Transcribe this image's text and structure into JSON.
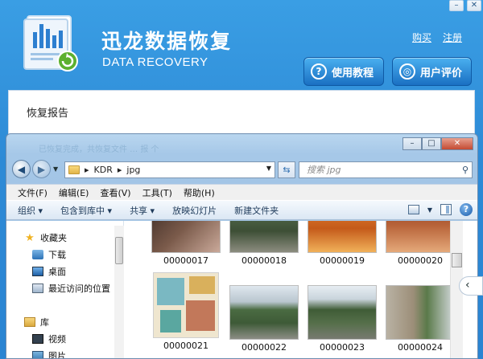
{
  "app": {
    "title": "迅龙数据恢复",
    "subtitle": "DATA RECOVERY",
    "links": {
      "buy": "购买",
      "register": "注册"
    },
    "buttons": {
      "tutorial": "使用教程",
      "review": "用户评价"
    },
    "window_controls": {
      "minimize": "–",
      "close": "✕"
    },
    "report_title": "恢复报告",
    "ghost_status": "已恢复完成，共恢复文件 … 报 个"
  },
  "explorer": {
    "path": [
      "KDR",
      "jpg"
    ],
    "search_placeholder": "搜索 jpg",
    "window_controls": {
      "minimize": "–",
      "maximize": "□",
      "close": "✕"
    },
    "menu": [
      "文件(F)",
      "编辑(E)",
      "查看(V)",
      "工具(T)",
      "帮助(H)"
    ],
    "commands": [
      "组织 ▾",
      "包含到库中 ▾",
      "共享 ▾",
      "放映幻灯片",
      "新建文件夹"
    ],
    "nav": {
      "favorites": "收藏夹",
      "downloads": "下载",
      "desktop": "桌面",
      "recent": "最近访问的位置",
      "library": "库",
      "videos": "视频",
      "pictures": "图片"
    },
    "files": [
      "00000017",
      "00000018",
      "00000019",
      "00000020",
      "00000021",
      "00000022",
      "00000023",
      "00000024"
    ]
  },
  "icons": {
    "back": "arrow-left-icon",
    "refresh": "refresh-icon",
    "search": "search-icon",
    "help": "help-icon",
    "collapse_tab": "chevron-left-icon"
  },
  "colors": {
    "accent": "#2d8ad6",
    "button": "#1a6fc2",
    "close": "#c44a32"
  }
}
